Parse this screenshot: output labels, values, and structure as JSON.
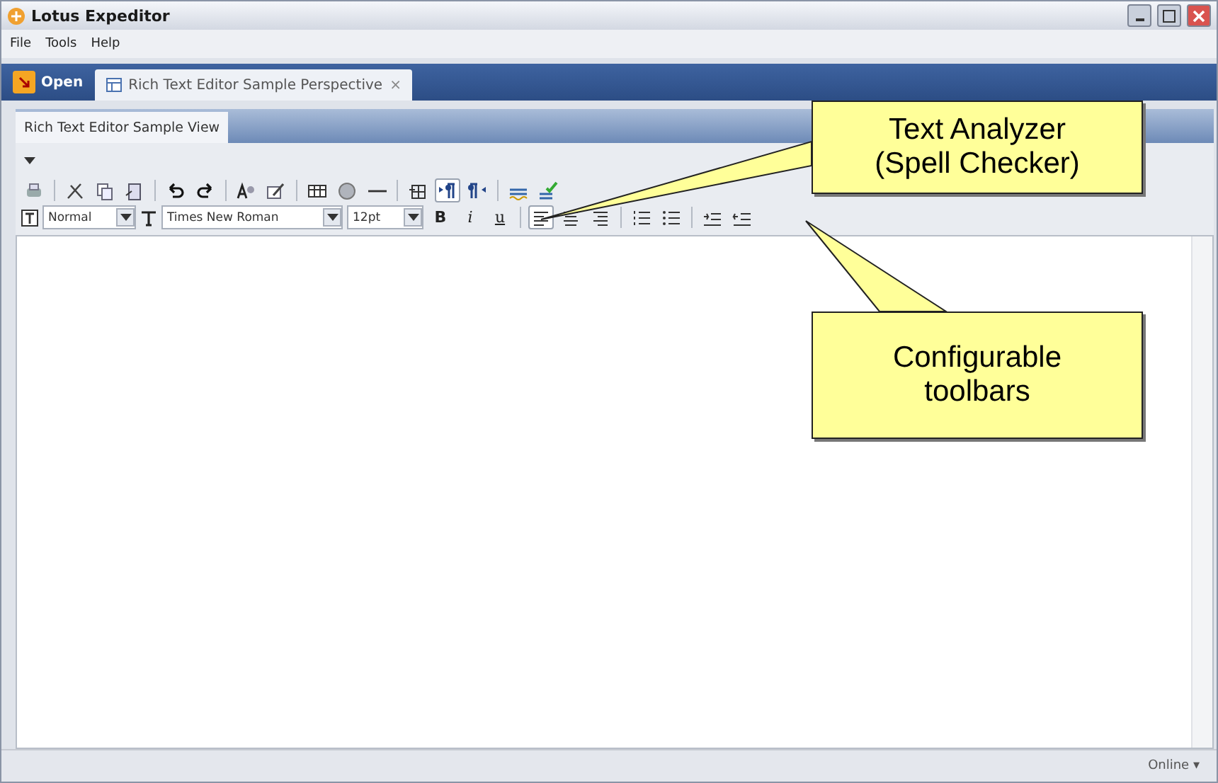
{
  "window": {
    "title": "Lotus Expeditor"
  },
  "menu": [
    "File",
    "Tools",
    "Help"
  ],
  "perspective_bar": {
    "open_button": "Open",
    "tabs": [
      {
        "label": "Rich Text Editor Sample Perspective",
        "close": "×",
        "selected": true
      }
    ]
  },
  "view_tabs": [
    {
      "label": "Rich Text Editor Sample View",
      "selected": true
    }
  ],
  "toolbar_1": [
    {
      "kind": "print",
      "selected": false
    },
    {
      "kind": "sep"
    },
    {
      "kind": "cut",
      "selected": false
    },
    {
      "kind": "copy",
      "selected": false
    },
    {
      "kind": "paste",
      "selected": false
    },
    {
      "kind": "sep"
    },
    {
      "kind": "undo",
      "selected": false
    },
    {
      "kind": "redo",
      "selected": false
    },
    {
      "kind": "sep"
    },
    {
      "kind": "font",
      "selected": false
    },
    {
      "kind": "brush",
      "selected": false
    },
    {
      "kind": "sep"
    },
    {
      "kind": "table",
      "selected": false
    },
    {
      "kind": "globe",
      "selected": false
    },
    {
      "kind": "rule",
      "selected": false
    },
    {
      "kind": "sep"
    },
    {
      "kind": "cells",
      "selected": false
    },
    {
      "kind": "ltr",
      "selected": true
    },
    {
      "kind": "rtl",
      "selected": false
    },
    {
      "kind": "sep"
    },
    {
      "kind": "spell",
      "selected": false
    },
    {
      "kind": "spellcheck",
      "selected": false
    }
  ],
  "toolbar_2": {
    "style": "Normal",
    "font": "Times New Roman",
    "size": "12pt",
    "buttons": [
      {
        "kind": "text",
        "label": "B",
        "selected": false
      },
      {
        "kind": "text",
        "label": "i",
        "selected": false
      },
      {
        "kind": "text",
        "label": "u",
        "selected": false
      },
      {
        "kind": "sep"
      },
      {
        "kind": "align-left",
        "selected": true
      },
      {
        "kind": "align-center",
        "selected": false
      },
      {
        "kind": "align-right",
        "selected": false
      },
      {
        "kind": "sep"
      },
      {
        "kind": "numbered",
        "selected": false
      },
      {
        "kind": "bulleted",
        "selected": false
      },
      {
        "kind": "sep"
      },
      {
        "kind": "indent",
        "selected": false
      },
      {
        "kind": "outdent",
        "selected": false
      }
    ]
  },
  "callouts": [
    {
      "kind": "spell",
      "lines": [
        "Text Analyzer",
        "(Spell Checker)"
      ]
    },
    {
      "kind": "toolbars",
      "lines": [
        "Configurable",
        "toolbars"
      ]
    }
  ],
  "status_bar": {
    "status": "Online",
    "caret": "▾"
  }
}
